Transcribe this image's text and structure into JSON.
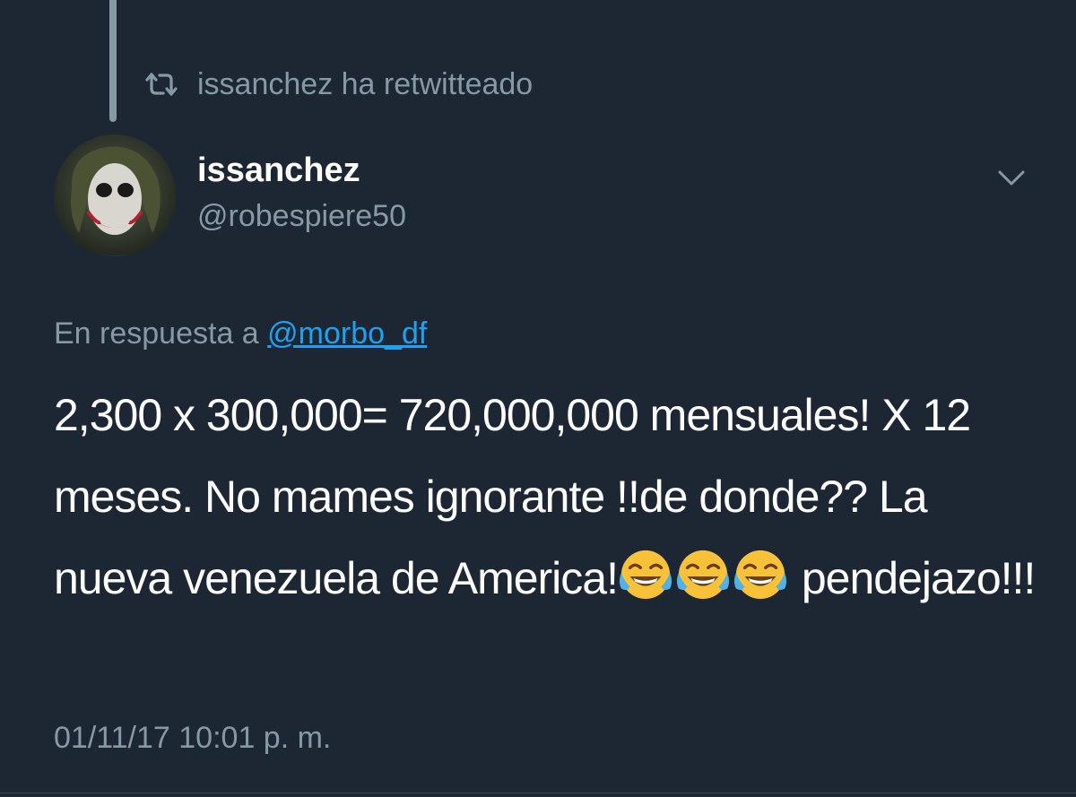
{
  "retweet": {
    "icon": "retweet-icon",
    "text": "issanchez ha retwitteado"
  },
  "author": {
    "display_name": "issanchez",
    "handle": "@robespiere50",
    "avatar": "avatar-joker"
  },
  "menu": {
    "icon": "chevron-down-icon"
  },
  "reply": {
    "prefix": "En respuesta a ",
    "mention": "@morbo_df"
  },
  "tweet": {
    "text_before_emoji": "2,300 x 300,000= 720,000,000 mensuales! X  12 meses. No mames ignorante !!de donde?? La nueva venezuela de America!",
    "emoji": [
      "face-with-tears-of-joy",
      "face-with-tears-of-joy",
      "face-with-tears-of-joy"
    ],
    "text_after_emoji": " pendejazo!!!"
  },
  "timestamp": "01/11/17 10:01 p. m.",
  "colors": {
    "background": "#1c2733",
    "secondary_text": "#8899a6",
    "primary_text": "#ffffff",
    "link": "#1da1f2"
  }
}
